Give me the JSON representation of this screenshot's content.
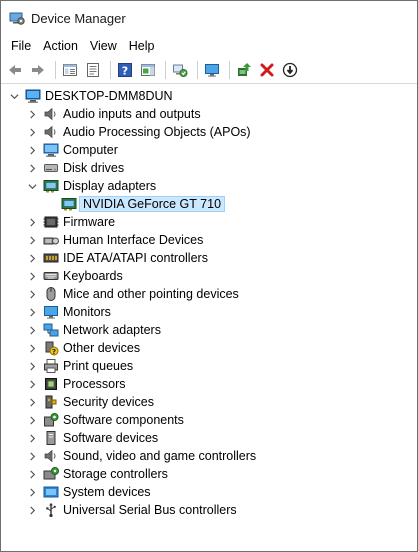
{
  "window": {
    "title": "Device Manager"
  },
  "menu": [
    "File",
    "Action",
    "View",
    "Help"
  ],
  "toolbar": {
    "buttons": [
      "back-arrow-icon",
      "forward-arrow-icon",
      "sep",
      "console-tree-icon",
      "properties-sheet-icon",
      "sep",
      "help-icon",
      "action-pane-icon",
      "sep",
      "scan-hardware-icon",
      "sep",
      "monitor-icon",
      "sep",
      "update-driver-icon",
      "uninstall-icon",
      "disable-device-icon"
    ]
  },
  "tree": {
    "root": "DESKTOP-DMM8DUN",
    "categories": [
      {
        "label": "Audio inputs and outputs",
        "icon": "speaker-icon",
        "expanded": false
      },
      {
        "label": "Audio Processing Objects (APOs)",
        "icon": "speaker-icon",
        "expanded": false
      },
      {
        "label": "Computer",
        "icon": "computer-icon",
        "expanded": false
      },
      {
        "label": "Disk drives",
        "icon": "disk-drive-icon",
        "expanded": false
      },
      {
        "label": "Display adapters",
        "icon": "display-adapter-icon",
        "expanded": true,
        "children": [
          {
            "label": "NVIDIA GeForce GT 710",
            "icon": "display-adapter-icon",
            "selected": true
          }
        ]
      },
      {
        "label": "Firmware",
        "icon": "firmware-icon",
        "expanded": false
      },
      {
        "label": "Human Interface Devices",
        "icon": "hid-icon",
        "expanded": false
      },
      {
        "label": "IDE ATA/ATAPI controllers",
        "icon": "ide-controller-icon",
        "expanded": false
      },
      {
        "label": "Keyboards",
        "icon": "keyboard-icon",
        "expanded": false
      },
      {
        "label": "Mice and other pointing devices",
        "icon": "mouse-icon",
        "expanded": false
      },
      {
        "label": "Monitors",
        "icon": "monitor-icon",
        "expanded": false
      },
      {
        "label": "Network adapters",
        "icon": "network-adapter-icon",
        "expanded": false
      },
      {
        "label": "Other devices",
        "icon": "unknown-device-icon",
        "expanded": false
      },
      {
        "label": "Print queues",
        "icon": "printer-icon",
        "expanded": false
      },
      {
        "label": "Processors",
        "icon": "processor-icon",
        "expanded": false
      },
      {
        "label": "Security devices",
        "icon": "security-device-icon",
        "expanded": false
      },
      {
        "label": "Software components",
        "icon": "software-component-icon",
        "expanded": false
      },
      {
        "label": "Software devices",
        "icon": "software-device-icon",
        "expanded": false
      },
      {
        "label": "Sound, video and game controllers",
        "icon": "speaker-icon",
        "expanded": false
      },
      {
        "label": "Storage controllers",
        "icon": "storage-controller-icon",
        "expanded": false
      },
      {
        "label": "System devices",
        "icon": "system-device-icon",
        "expanded": false
      },
      {
        "label": "Universal Serial Bus controllers",
        "icon": "usb-icon",
        "expanded": false
      }
    ]
  },
  "colors": {
    "selection_bg": "#cce8ff",
    "selection_border": "#99d1ff",
    "accent": "#2e7fd1",
    "uninstall": "#d11b1b"
  }
}
